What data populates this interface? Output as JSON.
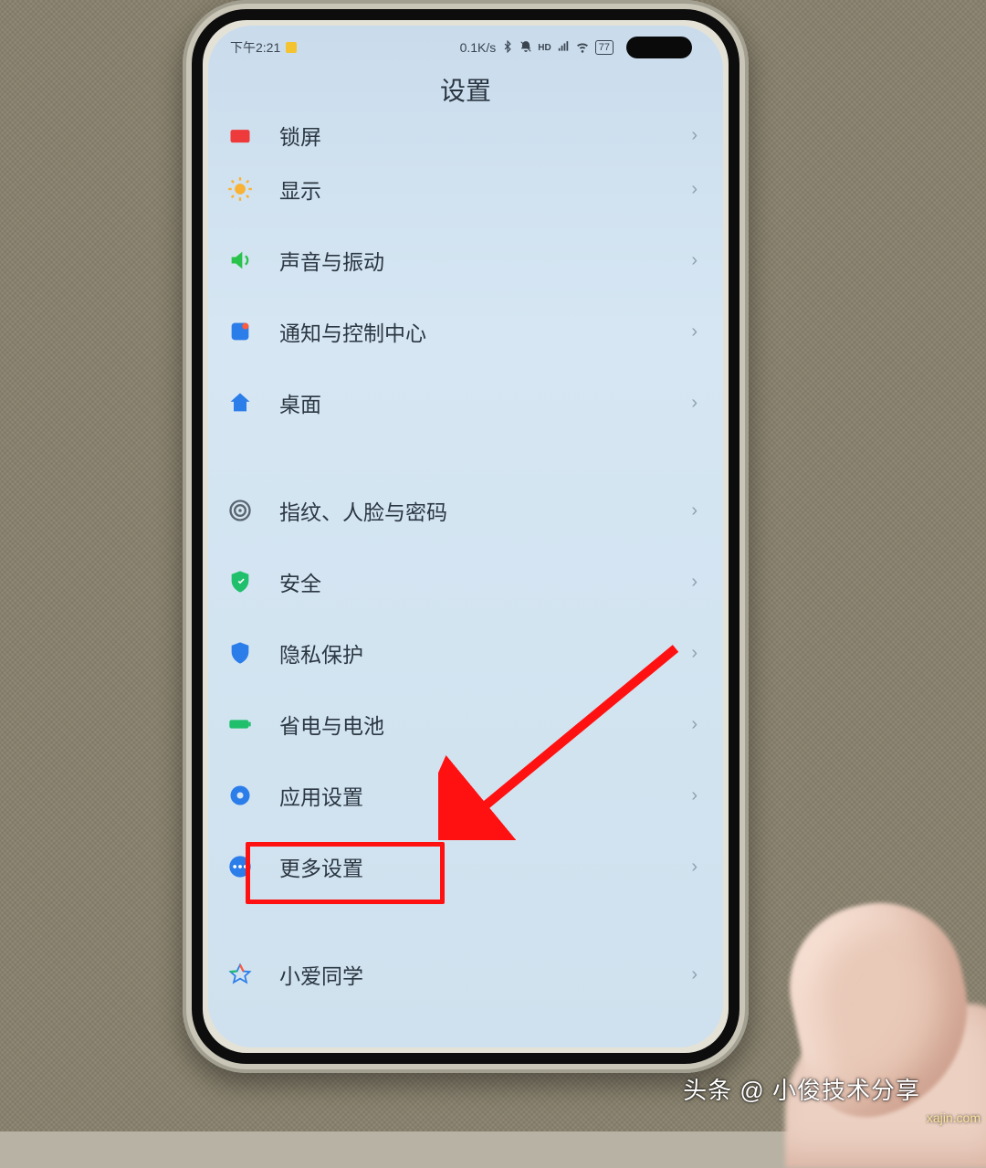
{
  "status": {
    "time": "下午2:21",
    "net_speed": "0.1K/s",
    "battery": "77"
  },
  "page_title": "设置",
  "items": [
    {
      "key": "lock",
      "label": "锁屏"
    },
    {
      "key": "display",
      "label": "显示"
    },
    {
      "key": "sound",
      "label": "声音与振动"
    },
    {
      "key": "notif",
      "label": "通知与控制中心"
    },
    {
      "key": "home",
      "label": "桌面"
    },
    {
      "key": "bio",
      "label": "指纹、人脸与密码"
    },
    {
      "key": "security",
      "label": "安全"
    },
    {
      "key": "privacy",
      "label": "隐私保护"
    },
    {
      "key": "battery",
      "label": "省电与电池"
    },
    {
      "key": "apps",
      "label": "应用设置"
    },
    {
      "key": "more",
      "label": "更多设置"
    },
    {
      "key": "ai",
      "label": "小爱同学"
    }
  ],
  "annotation": {
    "highlight_item": "more",
    "arrow_points_to": "more"
  },
  "footer": {
    "watermark": "头条 @ 小俊技术分享",
    "site": "xajin.com"
  }
}
